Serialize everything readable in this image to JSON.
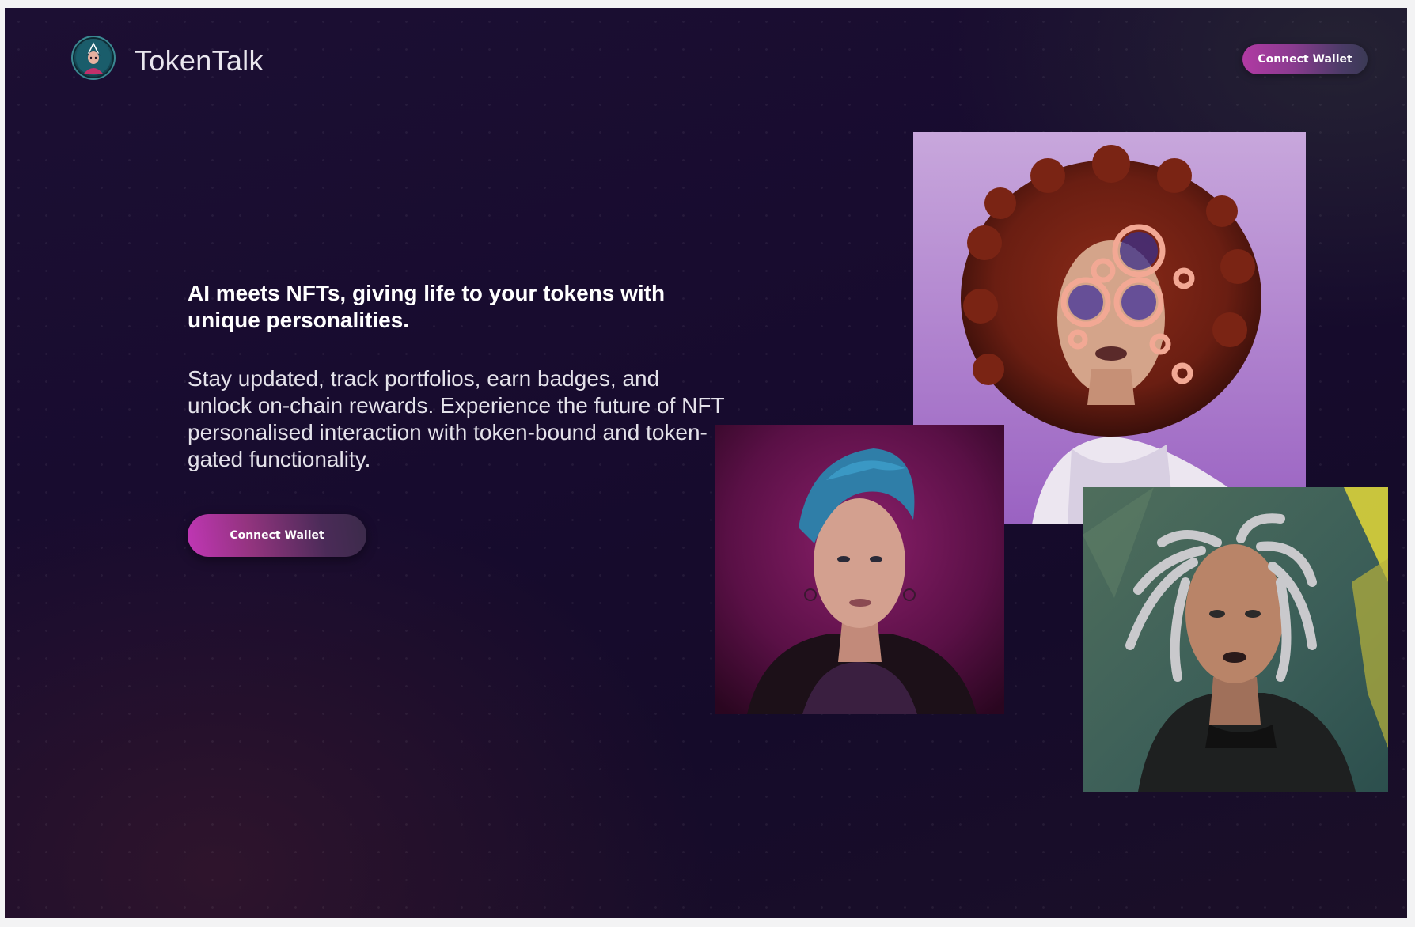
{
  "header": {
    "brand_name": "TokenTalk",
    "logo_icon": "avatar-logo-icon",
    "connect_wallet_label": "Connect Wallet"
  },
  "hero": {
    "headline": "AI meets NFTs, giving life to your tokens with unique personalities.",
    "description": "Stay updated, track portfolios, earn badges, and unlock on-chain rewards. Experience the future of NFT personalised interaction with token-bound and token-gated functionality.",
    "cta_label": "Connect Wallet"
  },
  "gallery": [
    {
      "name": "nft-portrait-curly-hair",
      "icon": "portrait-image"
    },
    {
      "name": "nft-portrait-blue-hair",
      "icon": "portrait-image"
    },
    {
      "name": "nft-portrait-silver-dreadlocks",
      "icon": "portrait-image"
    }
  ],
  "colors": {
    "background": "#170b2e",
    "button_accent": "#c136b6",
    "text": "#ffffff"
  }
}
